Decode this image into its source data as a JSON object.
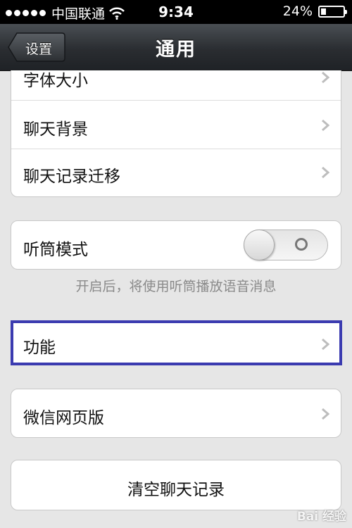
{
  "status_bar": {
    "carrier": "中国联通",
    "time": "9:34",
    "battery_percent": "24%",
    "battery_level": 0.24
  },
  "nav": {
    "back_label": "设置",
    "title": "通用"
  },
  "groups": {
    "chat": [
      "字体大小",
      "聊天背景",
      "聊天记录迁移"
    ],
    "earpiece": {
      "label": "听筒模式",
      "enabled": false,
      "hint": "开启后，将使用听筒播放语音消息"
    },
    "features": {
      "label": "功能"
    },
    "web": {
      "label": "微信网页版"
    },
    "clear": {
      "label": "清空聊天记录"
    }
  },
  "watermark": "Bai 经验",
  "colors": {
    "highlight_border": "#3b3bb0",
    "background": "#e6e6e6"
  }
}
